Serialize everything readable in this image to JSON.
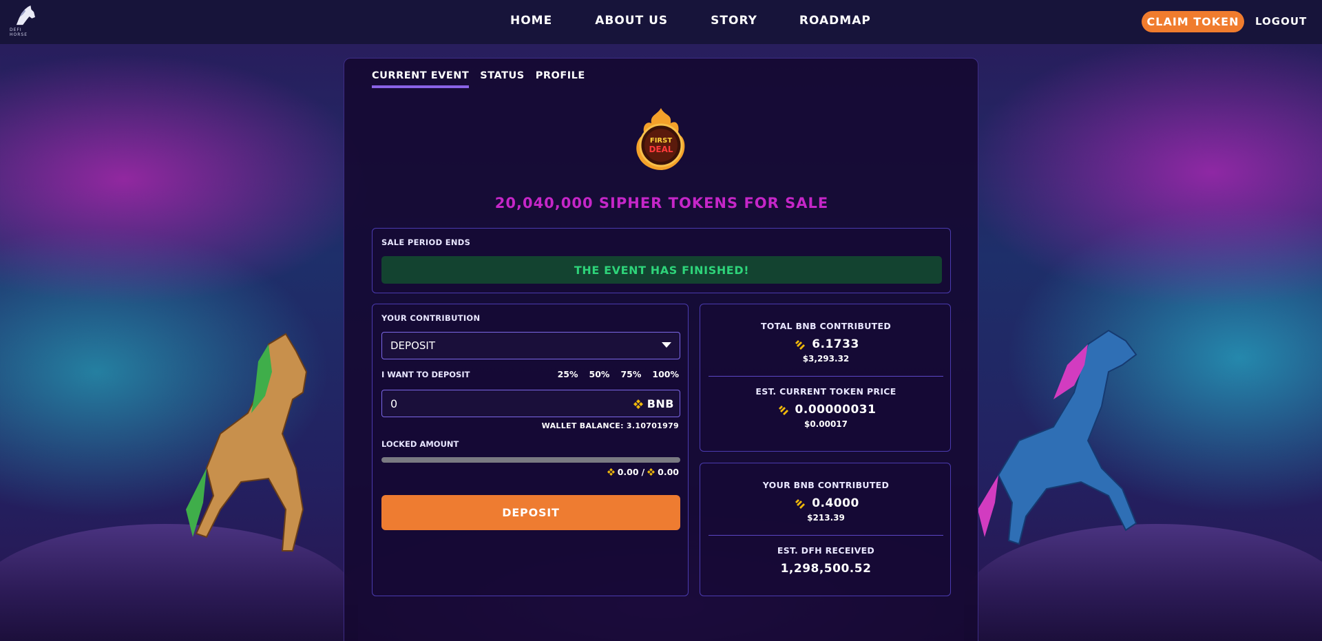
{
  "brand": {
    "name": "DEFI HORSE"
  },
  "nav": {
    "items": [
      "HOME",
      "ABOUT US",
      "STORY",
      "ROADMAP"
    ],
    "claim_label": "CLAIM TOKEN",
    "logout_label": "LOGOUT"
  },
  "tabs": [
    "CURRENT EVENT",
    "STATUS",
    "PROFILE"
  ],
  "event": {
    "logo_text": [
      "FIRST",
      "DEAL"
    ],
    "title": "20,040,000 SIPHER TOKENS FOR SALE",
    "sale_period_label": "SALE PERIOD ENDS",
    "status_message": "THE EVENT HAS FINISHED!"
  },
  "contribution": {
    "label": "YOUR CONTRIBUTION",
    "action_selected": "DEPOSIT",
    "deposit_label": "I WANT TO DEPOSIT",
    "percentages": [
      "25%",
      "50%",
      "75%",
      "100%"
    ],
    "amount_value": "0",
    "unit": "BNB",
    "wallet_balance": "WALLET BALANCE: 3.10701979",
    "locked_label": "LOCKED AMOUNT",
    "locked_progress": 0,
    "locked_current": "0.00",
    "locked_separator": "/",
    "locked_total": "0.00",
    "button_label": "DEPOSIT"
  },
  "stats": {
    "total_bnb_label": "TOTAL BNB CONTRIBUTED",
    "total_bnb_value": "6.1733",
    "total_bnb_usd": "$3,293.32",
    "token_price_label": "EST. CURRENT TOKEN PRICE",
    "token_price_value": "0.00000031",
    "token_price_usd": "$0.00017",
    "your_bnb_label": "YOUR BNB CONTRIBUTED",
    "your_bnb_value": "0.4000",
    "your_bnb_usd": "$213.39",
    "dfh_label": "EST. DFH RECEIVED",
    "dfh_value": "1,298,500.52"
  },
  "colors": {
    "accent_orange": "#f07c2e",
    "title_magenta": "#c526c8",
    "success_green": "#2ed47a",
    "border_purple": "#4b3bb0",
    "bnb_gold": "#f0b90b"
  }
}
